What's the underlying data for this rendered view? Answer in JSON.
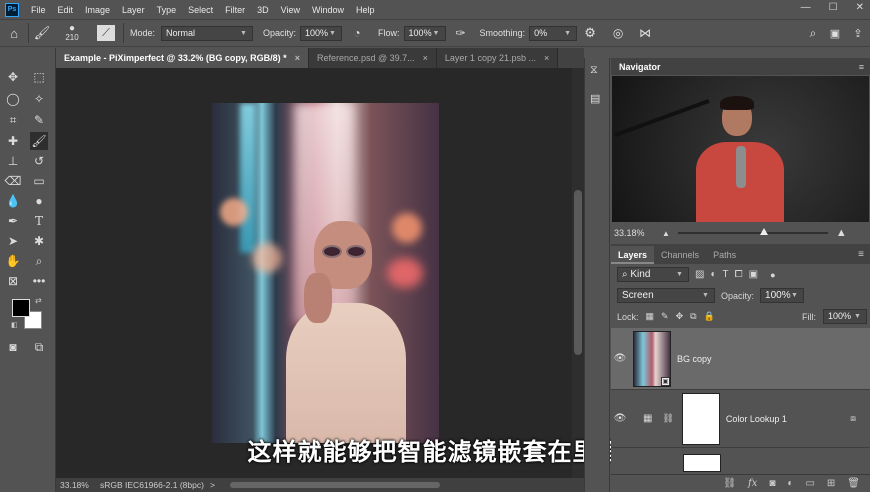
{
  "app": {
    "logo": "Ps"
  },
  "menu": [
    "File",
    "Edit",
    "Image",
    "Layer",
    "Type",
    "Select",
    "Filter",
    "3D",
    "View",
    "Window",
    "Help"
  ],
  "window_controls": [
    "—",
    "☐",
    "✕"
  ],
  "options": {
    "brush_size": "210",
    "mode_label": "Mode:",
    "mode_value": "Normal",
    "opacity_label": "Opacity:",
    "opacity_value": "100%",
    "flow_label": "Flow:",
    "flow_value": "100%",
    "smoothing_label": "Smoothing:",
    "smoothing_value": "0%"
  },
  "tabs": [
    {
      "label": "Example - PiXimperfect @ 33.2% (BG copy, RGB/8) *",
      "close": "×"
    },
    {
      "label": "Reference.psd @ 39.7...",
      "close": "×"
    },
    {
      "label": "Layer 1 copy 21.psb ...",
      "close": "×"
    }
  ],
  "subtitle": "这样就能够把智能滤镜嵌套在里面",
  "status": {
    "zoom": "33.18%",
    "profile": "sRGB IEC61966-2.1 (8bpc)",
    "arrow": ">"
  },
  "navigator": {
    "title": "Navigator",
    "zoom": "33.18%",
    "zoom_level": 0.55
  },
  "layers_panel": {
    "tabs": [
      "Layers",
      "Channels",
      "Paths"
    ],
    "filter_kind": "Kind",
    "blend_mode": "Screen",
    "opacity_label": "Opacity:",
    "opacity_value": "100%",
    "lock_label": "Lock:",
    "fill_label": "Fill:",
    "fill_value": "100%",
    "layers": [
      {
        "name": "BG copy",
        "selected": true
      },
      {
        "name": "Color Lookup 1",
        "selected": false
      }
    ],
    "footer_icons": [
      "link-icon",
      "fx-icon",
      "mask-icon",
      "adjustment-icon",
      "group-icon",
      "new-layer-icon",
      "trash-icon"
    ]
  },
  "colors": {
    "accent": "#31a8ff",
    "panel": "#535353",
    "canvas_bg": "#282828",
    "selected_layer": "#6a6a6a"
  }
}
